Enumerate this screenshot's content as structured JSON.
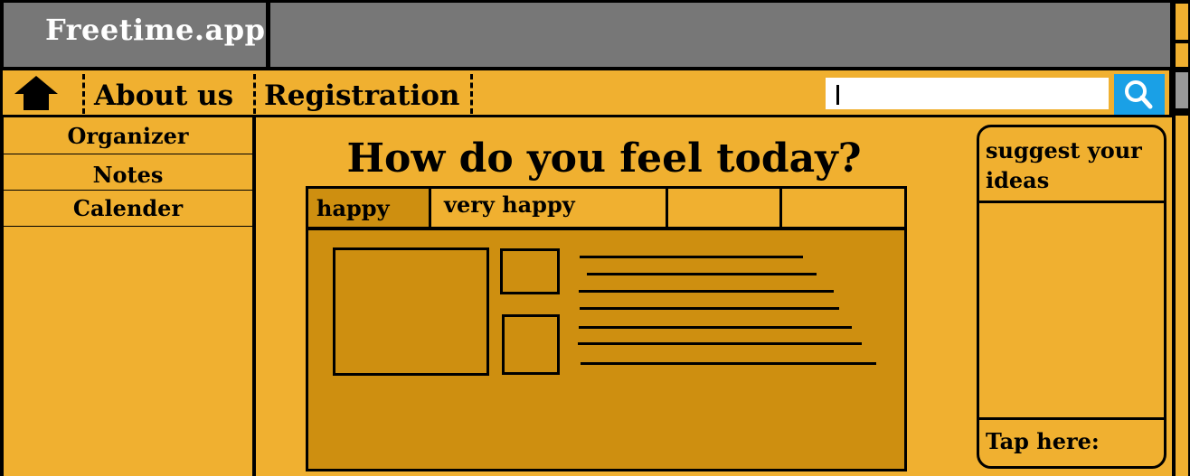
{
  "app": {
    "title": "Freetime.app"
  },
  "nav": {
    "home_icon": "home-icon",
    "items": [
      {
        "label": "About us"
      },
      {
        "label": "Registration"
      }
    ],
    "search": {
      "value": "",
      "placeholder": "",
      "icon": "search-icon"
    }
  },
  "sidebar": {
    "items": [
      {
        "label": "Organizer"
      },
      {
        "label": "Notes"
      },
      {
        "label": "Calender"
      }
    ]
  },
  "main": {
    "title": "How do you feel today?",
    "tabs": [
      {
        "label": "happy"
      },
      {
        "label": "very happy"
      },
      {
        "label": ""
      },
      {
        "label": ""
      }
    ]
  },
  "right_panel": {
    "title": "suggest your ideas",
    "footer": "Tap here:"
  },
  "colors": {
    "background": "#F0B030",
    "content": "#CE8F10",
    "title_bar": "#777777",
    "search_button": "#1AA0E6"
  }
}
